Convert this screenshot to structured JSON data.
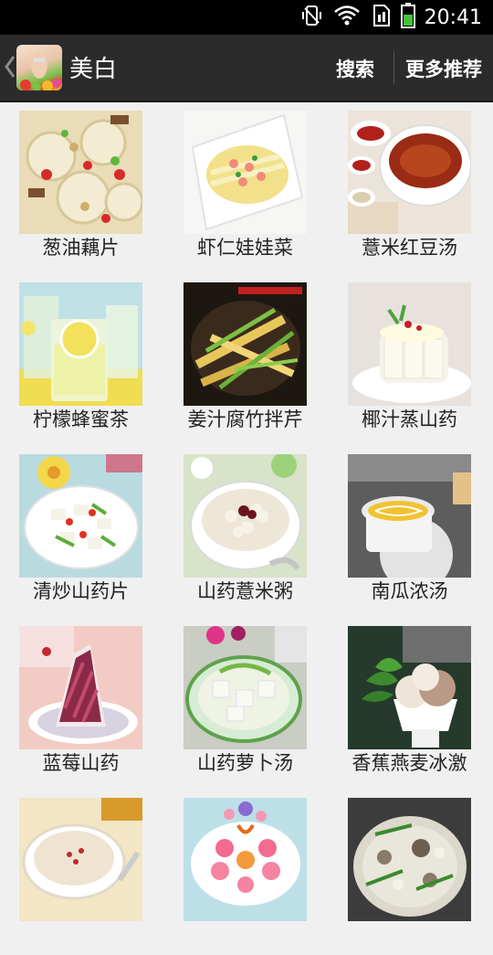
{
  "status_bar": {
    "time": "20:41"
  },
  "app_bar": {
    "title": "美白",
    "search_label": "搜索",
    "more_label": "更多推荐"
  },
  "recipes": [
    {
      "name": "葱油藕片"
    },
    {
      "name": "虾仁娃娃菜"
    },
    {
      "name": "薏米红豆汤"
    },
    {
      "name": "柠檬蜂蜜茶"
    },
    {
      "name": "姜汁腐竹拌芹"
    },
    {
      "name": "椰汁蒸山药"
    },
    {
      "name": "清炒山药片"
    },
    {
      "name": "山药薏米粥"
    },
    {
      "name": "南瓜浓汤"
    },
    {
      "name": "蓝莓山药"
    },
    {
      "name": "山药萝卜汤"
    },
    {
      "name": "香蕉燕麦冰激"
    }
  ]
}
